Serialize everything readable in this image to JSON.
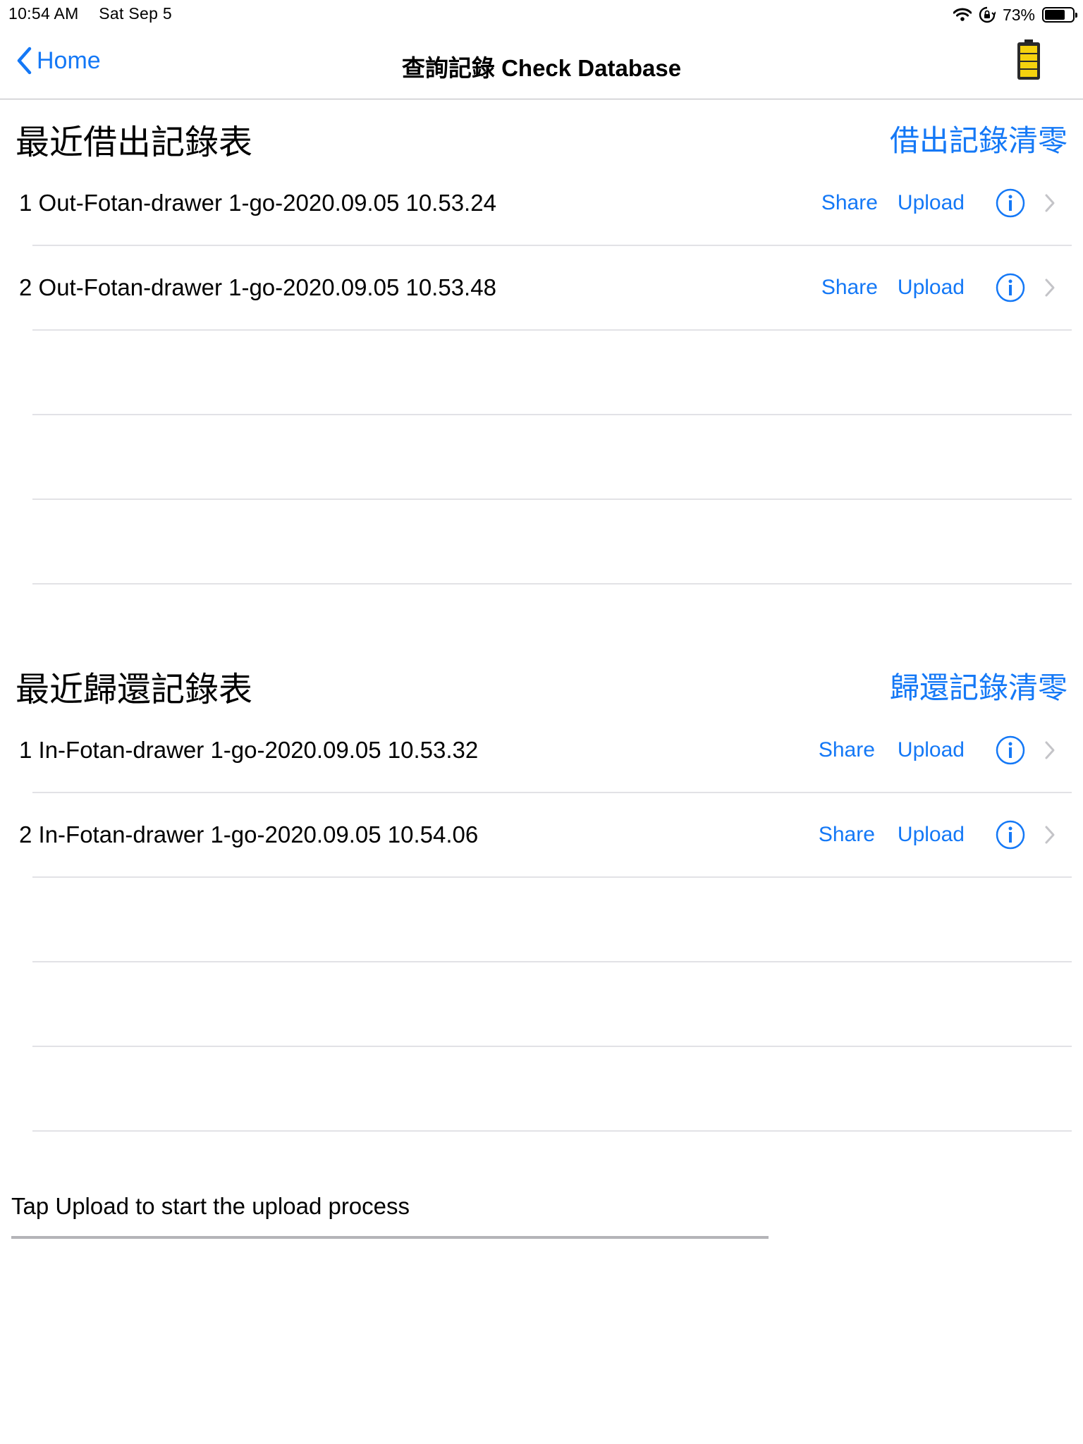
{
  "status": {
    "time": "10:54 AM",
    "date": "Sat Sep 5",
    "battery": "73%",
    "battery_level": 0.73
  },
  "nav": {
    "back_label": "Home",
    "title": "查詢記錄 Check Database"
  },
  "borrow": {
    "title": "最近借出記錄表",
    "clear_label": "借出記錄清零",
    "rows": [
      {
        "label": "1 Out-Fotan-drawer 1-go-2020.09.05 10.53.24",
        "share": "Share",
        "upload": "Upload"
      },
      {
        "label": "2 Out-Fotan-drawer 1-go-2020.09.05 10.53.48",
        "share": "Share",
        "upload": "Upload"
      }
    ]
  },
  "return": {
    "title": "最近歸還記錄表",
    "clear_label": "歸還記錄清零",
    "rows": [
      {
        "label": "1 In-Fotan-drawer 1-go-2020.09.05 10.53.32",
        "share": "Share",
        "upload": "Upload"
      },
      {
        "label": "2 In-Fotan-drawer 1-go-2020.09.05 10.54.06",
        "share": "Share",
        "upload": "Upload"
      }
    ]
  },
  "hint": "Tap Upload to start the upload process",
  "colors": {
    "accent": "#1478f6",
    "separator": "#e2e2e6",
    "battery_icon_yellow": "#f5d20e"
  },
  "icons": [
    "wifi-icon",
    "orientation-lock-icon",
    "battery-icon",
    "chevron-left-icon",
    "battery-level-icon",
    "info-icon",
    "chevron-right-icon"
  ]
}
